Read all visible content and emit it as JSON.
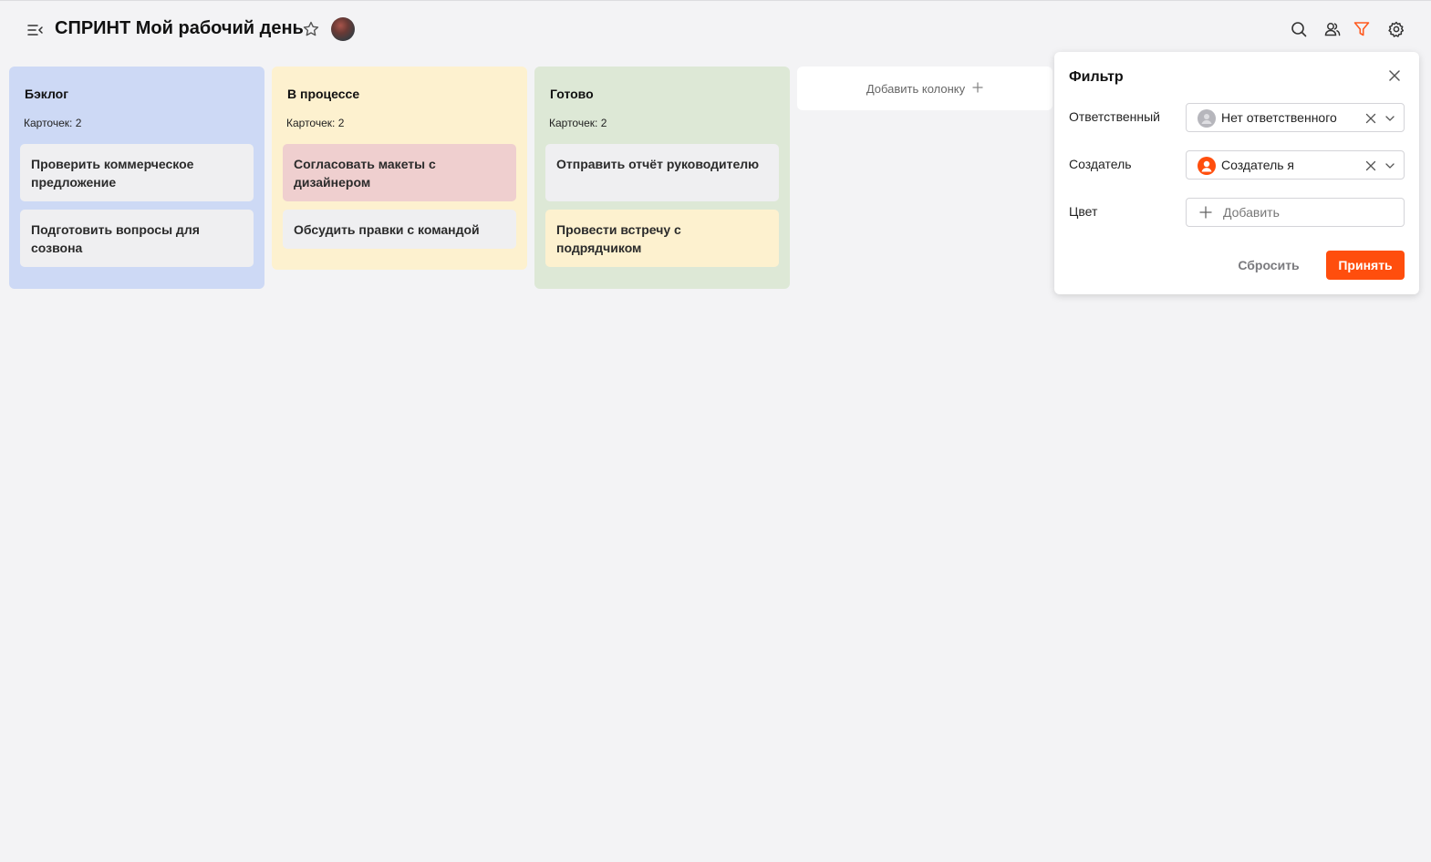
{
  "header": {
    "title": "СПРИНТ Мой рабочий день",
    "icons": [
      "menu-collapse-icon",
      "star-icon",
      "search-icon",
      "users-icon",
      "filter-icon",
      "gear-icon"
    ]
  },
  "colors": {
    "accent": "#ff4e0d",
    "backlog_bg": "#cdd9f5",
    "progress_bg": "#fdf1cf",
    "done_bg": "#dde8d6",
    "card_default": "#efeff1",
    "card_red": "#efcfcf",
    "card_yellow": "#fdf1cf",
    "filter_active": "#ff5a1f"
  },
  "board": {
    "columns": [
      {
        "title": "Бэклог",
        "count_text": "Карточек: 2",
        "cards": [
          {
            "text": "Проверить коммерческое предложение"
          },
          {
            "text": "Подготовить вопросы для созвона"
          }
        ]
      },
      {
        "title": "В процессе",
        "count_text": "Карточек: 2",
        "cards": [
          {
            "text": "Согласовать макеты с дизайнером"
          },
          {
            "text": "Обсудить правки с командой"
          }
        ]
      },
      {
        "title": "Готово",
        "count_text": "Карточек: 2",
        "cards": [
          {
            "text": "Отправить отчёт руководителю"
          },
          {
            "text": "Провести встречу с подрядчиком"
          }
        ]
      }
    ],
    "add_column_label": "Добавить колонку"
  },
  "filter": {
    "title": "Фильтр",
    "assignee": {
      "label": "Ответственный",
      "value": "Нет ответственного"
    },
    "creator": {
      "label": "Создатель",
      "value": "Создатель я"
    },
    "color": {
      "label": "Цвет",
      "placeholder": "Добавить"
    },
    "reset_label": "Сбросить",
    "apply_label": "Принять"
  }
}
